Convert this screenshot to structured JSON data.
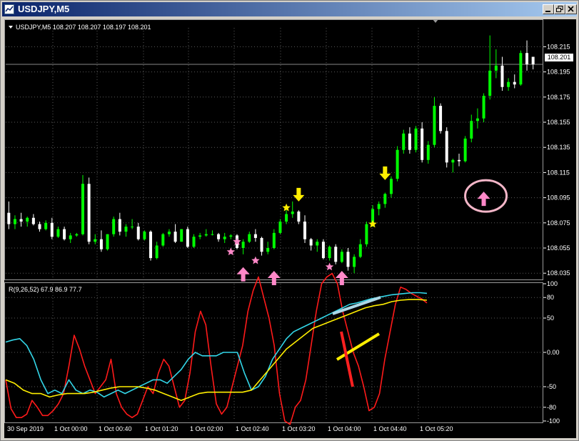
{
  "window": {
    "title": "USDJPY,M5"
  },
  "chart_header": "USDJPY,M5  108.207 108.207 108.197 108.201",
  "indicator_label": "R(9,26,52) 67.9 86.9 77.7",
  "current_price": "108.201",
  "price_axis": [
    "108.215",
    "108.195",
    "108.175",
    "108.155",
    "108.135",
    "108.115",
    "108.095",
    "108.075",
    "108.055",
    "108.035"
  ],
  "indicator_axis": [
    "100",
    "80",
    "50",
    "0.00",
    "-50",
    "-80",
    "-100"
  ],
  "time_axis": [
    "30 Sep 2019",
    "1 Oct 00:00",
    "1 Oct 00:40",
    "1 Oct 01:20",
    "1 Oct 02:00",
    "1 Oct 02:40",
    "1 Oct 03:20",
    "1 Oct 04:00",
    "1 Oct 04:40",
    "1 Oct 05:20"
  ],
  "colors": {
    "bull": "#00ff00",
    "bear": "#ffffff",
    "grid": "#5a5a5a",
    "red_line": "#ff1a1a",
    "cyan_line": "#33d6e8",
    "yellow_line": "#ffee00",
    "pink_arrow": "#ff88c8",
    "yellow_arrow": "#ffee00"
  },
  "icons": {
    "window-icon": "chart-window",
    "minimize": "minimize-icon",
    "restore": "restore-icon",
    "close": "close-icon"
  },
  "chart_data": {
    "type": "candlestick",
    "symbol": "USDJPY",
    "timeframe": "M5",
    "ohlc_header": {
      "open": 108.207,
      "high": 108.207,
      "low": 108.197,
      "close": 108.201
    },
    "price_range": [
      108.03,
      108.23
    ],
    "candles": [
      [
        108.083,
        108.092,
        108.07,
        108.074
      ],
      [
        108.074,
        108.081,
        108.07,
        108.078
      ],
      [
        108.078,
        108.083,
        108.072,
        108.076
      ],
      [
        108.076,
        108.08,
        108.072,
        108.079
      ],
      [
        108.079,
        108.082,
        108.073,
        108.074
      ],
      [
        108.074,
        108.076,
        108.068,
        108.07
      ],
      [
        108.07,
        108.077,
        108.069,
        108.075
      ],
      [
        108.075,
        108.079,
        108.062,
        108.064
      ],
      [
        108.064,
        108.072,
        108.063,
        108.07
      ],
      [
        108.07,
        108.072,
        108.061,
        108.062
      ],
      [
        108.062,
        108.067,
        108.059,
        108.065
      ],
      [
        108.065,
        108.067,
        108.064,
        108.066
      ],
      [
        108.066,
        108.113,
        108.065,
        108.106
      ],
      [
        108.106,
        108.111,
        108.058,
        108.06
      ],
      [
        108.06,
        108.066,
        108.058,
        108.062
      ],
      [
        108.062,
        108.069,
        108.052,
        108.054
      ],
      [
        108.054,
        108.066,
        108.053,
        108.066
      ],
      [
        108.066,
        108.08,
        108.064,
        108.078
      ],
      [
        108.078,
        108.083,
        108.065,
        108.068
      ],
      [
        108.068,
        108.074,
        108.064,
        108.072
      ],
      [
        108.072,
        108.078,
        108.07,
        108.072
      ],
      [
        108.072,
        108.075,
        108.061,
        108.062
      ],
      [
        108.062,
        108.069,
        108.061,
        108.068
      ],
      [
        108.068,
        108.069,
        108.045,
        108.047
      ],
      [
        108.047,
        108.06,
        108.046,
        108.057
      ],
      [
        108.057,
        108.067,
        108.056,
        108.066
      ],
      [
        108.066,
        108.07,
        108.064,
        108.068
      ],
      [
        108.068,
        108.074,
        108.059,
        108.06
      ],
      [
        108.06,
        108.07,
        108.06,
        108.07
      ],
      [
        108.07,
        108.072,
        108.055,
        108.056
      ],
      [
        108.056,
        108.066,
        108.055,
        108.064
      ],
      [
        108.064,
        108.067,
        108.062,
        108.065
      ],
      [
        108.065,
        108.07,
        108.064,
        108.066
      ],
      [
        108.066,
        108.069,
        108.065,
        108.066
      ],
      [
        108.066,
        108.067,
        108.06,
        108.062
      ],
      [
        108.062,
        108.067,
        108.059,
        108.064
      ],
      [
        108.064,
        108.066,
        108.062,
        108.065
      ],
      [
        108.065,
        108.066,
        108.054,
        108.055
      ],
      [
        108.055,
        108.062,
        108.05,
        108.06
      ],
      [
        108.06,
        108.068,
        108.059,
        108.066
      ],
      [
        108.066,
        108.07,
        108.06,
        108.063
      ],
      [
        108.063,
        108.064,
        108.049,
        108.052
      ],
      [
        108.052,
        108.06,
        108.05,
        108.055
      ],
      [
        108.055,
        108.07,
        108.054,
        108.067
      ],
      [
        108.067,
        108.078,
        108.066,
        108.076
      ],
      [
        108.076,
        108.085,
        108.074,
        108.082
      ],
      [
        108.082,
        108.092,
        108.079,
        108.084
      ],
      [
        108.084,
        108.085,
        108.074,
        108.076
      ],
      [
        108.076,
        108.081,
        108.059,
        108.062
      ],
      [
        108.062,
        108.063,
        108.053,
        108.057
      ],
      [
        108.057,
        108.062,
        108.052,
        108.06
      ],
      [
        108.06,
        108.062,
        108.046,
        108.047
      ],
      [
        108.047,
        108.057,
        108.045,
        108.056
      ],
      [
        108.056,
        108.058,
        108.042,
        108.044
      ],
      [
        108.044,
        108.054,
        108.043,
        108.052
      ],
      [
        108.052,
        108.055,
        108.037,
        108.04
      ],
      [
        108.04,
        108.05,
        108.035,
        108.048
      ],
      [
        108.048,
        108.062,
        108.047,
        108.058
      ],
      [
        108.058,
        108.076,
        108.056,
        108.074
      ],
      [
        108.074,
        108.089,
        108.072,
        108.086
      ],
      [
        108.086,
        108.092,
        108.081,
        108.09
      ],
      [
        108.09,
        108.099,
        108.087,
        108.098
      ],
      [
        108.098,
        108.112,
        108.095,
        108.11
      ],
      [
        108.11,
        108.136,
        108.108,
        108.133
      ],
      [
        108.133,
        108.149,
        108.13,
        108.146
      ],
      [
        108.146,
        108.151,
        108.13,
        108.133
      ],
      [
        108.133,
        108.152,
        108.131,
        108.15
      ],
      [
        108.15,
        108.155,
        108.123,
        108.125
      ],
      [
        108.125,
        108.14,
        108.122,
        108.137
      ],
      [
        108.137,
        108.175,
        108.135,
        108.168
      ],
      [
        108.168,
        108.17,
        108.146,
        108.148
      ],
      [
        108.148,
        108.151,
        108.119,
        108.123
      ],
      [
        108.123,
        108.126,
        108.115,
        108.125
      ],
      [
        108.125,
        108.13,
        108.12,
        108.124
      ],
      [
        108.124,
        108.144,
        108.123,
        108.142
      ],
      [
        108.142,
        108.161,
        108.139,
        108.156
      ],
      [
        108.156,
        108.166,
        108.15,
        108.158
      ],
      [
        108.158,
        108.178,
        108.155,
        108.176
      ],
      [
        108.176,
        108.224,
        108.173,
        108.196
      ],
      [
        108.196,
        108.213,
        108.19,
        108.2
      ],
      [
        108.2,
        108.207,
        108.18,
        108.183
      ],
      [
        108.183,
        108.19,
        108.18,
        108.187
      ],
      [
        108.187,
        108.193,
        108.182,
        108.185
      ],
      [
        108.185,
        108.212,
        108.184,
        108.21
      ],
      [
        108.21,
        108.22,
        108.196,
        108.201
      ],
      [
        108.207,
        108.207,
        108.197,
        108.201
      ]
    ],
    "signals": {
      "down_arrows": [
        {
          "index": 47,
          "price": 108.096
        },
        {
          "index": 61,
          "price": 108.113
        }
      ],
      "stars": [
        {
          "index": 45,
          "price": 108.087
        },
        {
          "index": 59,
          "price": 108.074
        },
        {
          "index": 36,
          "price": 108.052
        },
        {
          "index": 40,
          "price": 108.045
        },
        {
          "index": 52,
          "price": 108.04
        },
        {
          "index": 37,
          "price": 108.06
        }
      ],
      "up_arrows": [
        {
          "index": 38,
          "price": 108.033
        },
        {
          "index": 43,
          "price": 108.03
        },
        {
          "index": 54,
          "price": 108.03
        },
        {
          "index": 77,
          "price": 108.093
        }
      ],
      "highlight_circle": {
        "index": 77,
        "price": 108.097
      }
    },
    "indicator": {
      "name": "R(9,26,52)",
      "values": [
        67.9,
        86.9,
        77.7
      ],
      "ylim": [
        -100,
        100
      ],
      "series": [
        {
          "name": "R9",
          "color": "#ff1a1a",
          "values": [
            -40,
            -82,
            -95,
            -95,
            -90,
            -70,
            -80,
            -92,
            -92,
            -85,
            -75,
            -60,
            -20,
            25,
            5,
            -20,
            -40,
            -60,
            -50,
            -40,
            -10,
            -60,
            -80,
            -90,
            -95,
            -90,
            -70,
            -50,
            -60,
            -30,
            -10,
            -20,
            -50,
            -80,
            -70,
            -30,
            30,
            60,
            40,
            -20,
            -75,
            -90,
            -80,
            -50,
            -20,
            10,
            60,
            90,
            110,
            80,
            50,
            10,
            -60,
            -100,
            -105,
            -80,
            -70,
            -40,
            10,
            60,
            100,
            110,
            115,
            100,
            60,
            30,
            0,
            -20,
            -50,
            -85,
            -80,
            -60,
            -10,
            30,
            70,
            95,
            92,
            86,
            82,
            78,
            72
          ]
        },
        {
          "name": "R26",
          "color": "#33d6e8",
          "values": [
            15,
            18,
            20,
            10,
            -10,
            -40,
            -60,
            -55,
            -60,
            -40,
            -55,
            -60,
            -55,
            -58,
            -65,
            -60,
            -55,
            -60,
            -55,
            -50,
            -45,
            -40,
            -40,
            -45,
            -35,
            -25,
            -10,
            0,
            -5,
            -5,
            -5,
            0,
            0,
            0,
            -30,
            -55,
            -50,
            -35,
            -10,
            5,
            20,
            30,
            35,
            40,
            45,
            50,
            55,
            60,
            65,
            70,
            72,
            75,
            78,
            80,
            82,
            84,
            85,
            86,
            87,
            87,
            86
          ]
        },
        {
          "name": "R52",
          "color": "#ffee00",
          "values": [
            -40,
            -45,
            -55,
            -60,
            -60,
            -65,
            -62,
            -60,
            -60,
            -60,
            -58,
            -55,
            -52,
            -50,
            -50,
            -50,
            -52,
            -55,
            -60,
            -65,
            -70,
            -65,
            -60,
            -58,
            -58,
            -58,
            -58,
            -58,
            -55,
            -40,
            -25,
            -10,
            5,
            15,
            25,
            35,
            40,
            45,
            50,
            55,
            60,
            65,
            68,
            70,
            74,
            76,
            77,
            77,
            76
          ]
        }
      ]
    }
  }
}
